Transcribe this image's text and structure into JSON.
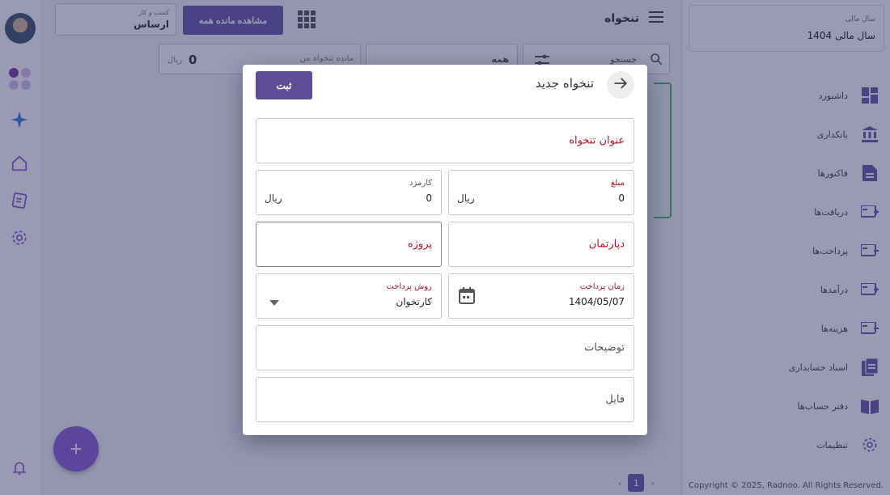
{
  "topbar": {
    "page_title": "تنخواه",
    "view_all_button": "مشاهده مانده همه",
    "business": {
      "label": "کسب و کار",
      "value": "ارساس"
    }
  },
  "filters": {
    "search_placeholder": "جستجو",
    "type_value": "همه",
    "balance_label": "مانده تنخواه من",
    "balance_value": "0",
    "balance_unit": "ریال"
  },
  "pagination": {
    "current": "1"
  },
  "sidebar": {
    "fiscal_year": {
      "label": "سال مالی",
      "value": "سال مالی 1404"
    },
    "items": [
      {
        "label": "داشبورد",
        "icon": "dashboard-icon"
      },
      {
        "label": "بانکداری",
        "icon": "bank-icon"
      },
      {
        "label": "فاکتورها",
        "icon": "invoice-icon"
      },
      {
        "label": "دریافت‌ها",
        "icon": "receive-icon"
      },
      {
        "label": "پرداخت‌ها",
        "icon": "payment-icon"
      },
      {
        "label": "درآمدها",
        "icon": "income-icon"
      },
      {
        "label": "هزینه‌ها",
        "icon": "expense-icon"
      },
      {
        "label": "اسناد حسابداری",
        "icon": "documents-icon"
      },
      {
        "label": "دفتر حساب‌ها",
        "icon": "ledger-icon"
      },
      {
        "label": "تنظیمات",
        "icon": "settings-icon"
      }
    ],
    "copyright": "Copyright © 2025, Radnoo. All Rights Reserved."
  },
  "modal": {
    "title": "تنخواه جدید",
    "submit_label": "ثبت",
    "fields": {
      "title_label": "عنوان تنخواه",
      "amount": {
        "label": "مبلغ",
        "value": "0",
        "unit": "ریال"
      },
      "fee": {
        "label": "کارمزد",
        "value": "0",
        "unit": "ریال"
      },
      "department_label": "دپارتمان",
      "project_label": "پروژه",
      "payment_time": {
        "label": "زمان پرداخت",
        "value": "1404/05/07"
      },
      "payment_method": {
        "label": "روش پرداخت",
        "value": "کارتخوان"
      },
      "description_label": "توضیحات",
      "file_label": "فایل"
    }
  },
  "colors": {
    "primary": "#5f4d97",
    "required_label": "#b3122e",
    "fab": "#8e5fd6",
    "overlay": "rgba(35,38,90,0.46)"
  }
}
